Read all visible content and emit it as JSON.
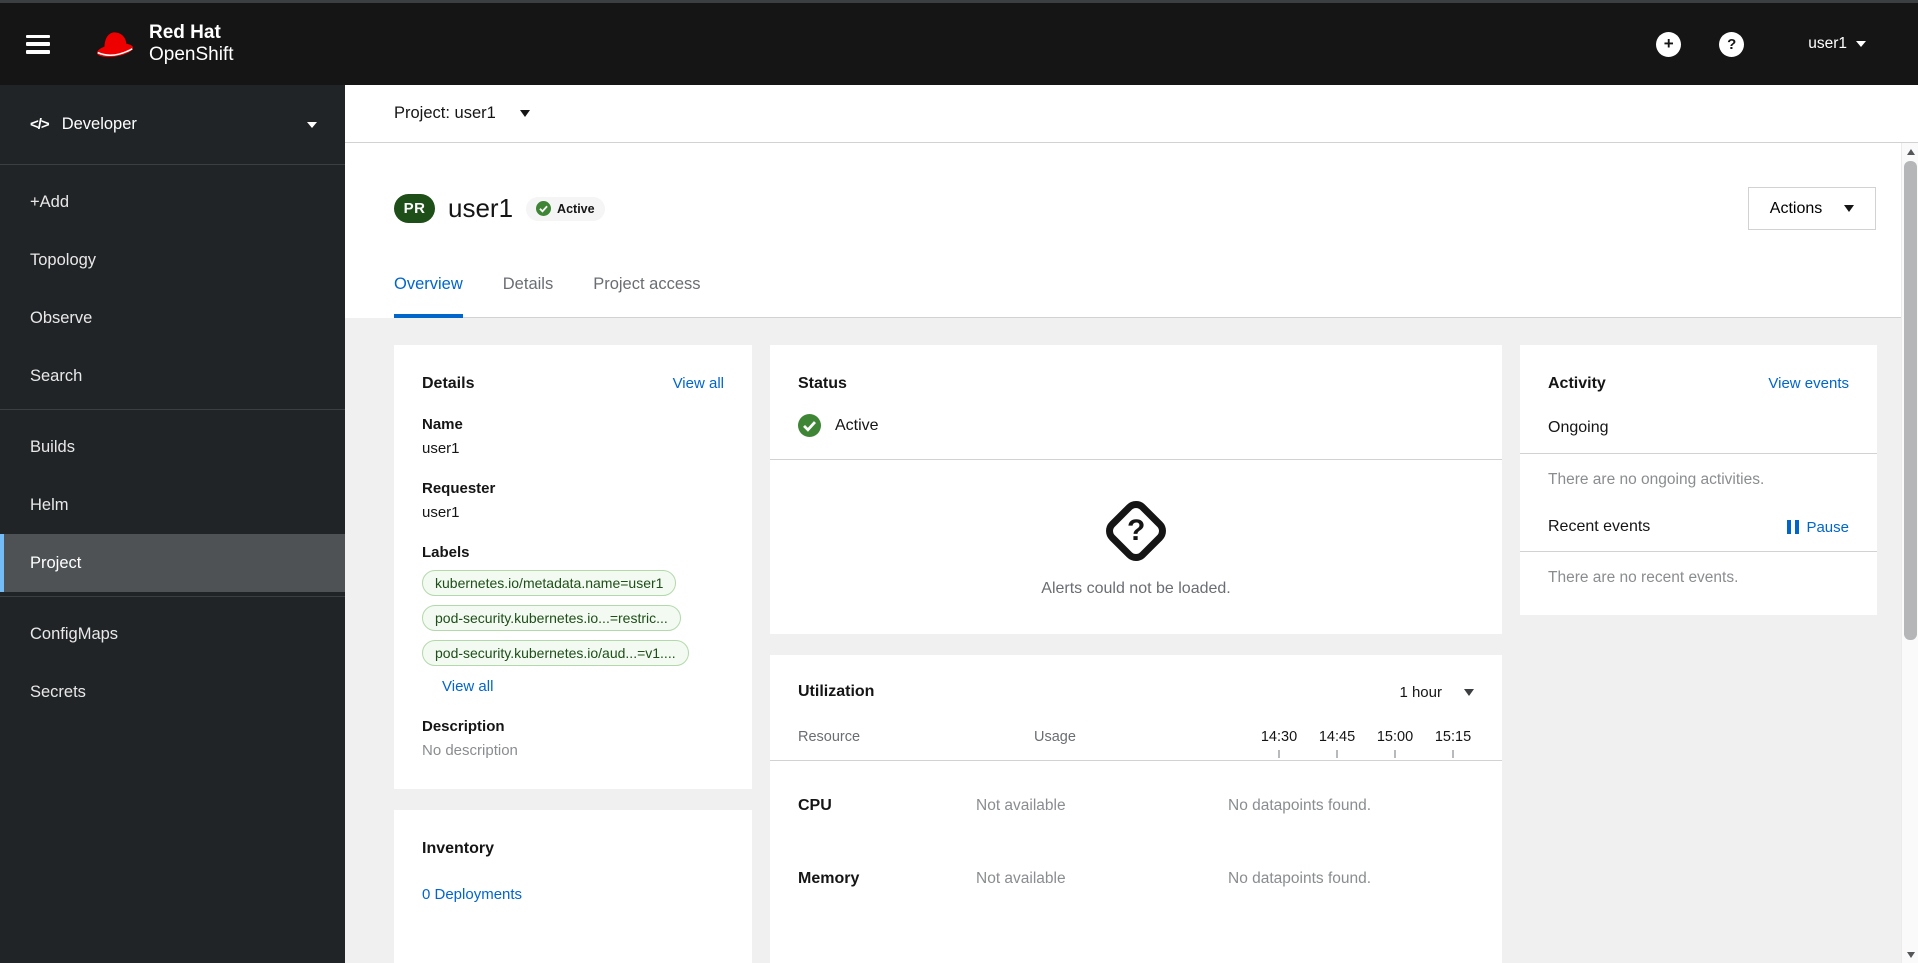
{
  "masthead": {
    "brand": {
      "line1": "Red Hat",
      "line2": "OpenShift"
    },
    "icons": {
      "plus": "+",
      "help": "?"
    },
    "user_menu": {
      "username": "user1"
    }
  },
  "sidebar": {
    "perspective": {
      "label": "Developer"
    },
    "groups": [
      {
        "items": [
          {
            "label": "+Add"
          },
          {
            "label": "Topology"
          },
          {
            "label": "Observe"
          },
          {
            "label": "Search"
          }
        ]
      },
      {
        "items": [
          {
            "label": "Builds"
          },
          {
            "label": "Helm"
          },
          {
            "label": "Project",
            "selected": true
          }
        ]
      },
      {
        "items": [
          {
            "label": "ConfigMaps"
          },
          {
            "label": "Secrets"
          }
        ]
      }
    ]
  },
  "project_bar": {
    "label": "Project: user1"
  },
  "page_header": {
    "resource_badge": "PR",
    "title": "user1",
    "status_badge": "Active",
    "actions_label": "Actions"
  },
  "tabs": [
    {
      "label": "Overview",
      "active": true
    },
    {
      "label": "Details",
      "active": false
    },
    {
      "label": "Project access",
      "active": false
    }
  ],
  "details_card": {
    "heading": "Details",
    "view_all_link": "View all",
    "name_label": "Name",
    "name_value": "user1",
    "requester_label": "Requester",
    "requester_value": "user1",
    "labels_label": "Labels",
    "labels": [
      "kubernetes.io/metadata.name=user1",
      "pod-security.kubernetes.io...=restric...",
      "pod-security.kubernetes.io/aud...=v1...."
    ],
    "labels_view_all_link": "View all",
    "description_label": "Description",
    "description_value": "No description"
  },
  "status_card": {
    "heading": "Status",
    "state": "Active",
    "alerts_message": "Alerts could not be loaded."
  },
  "activity_card": {
    "heading": "Activity",
    "view_events_link": "View events",
    "ongoing_heading": "Ongoing",
    "ongoing_empty": "There are no ongoing activities.",
    "recent_heading": "Recent events",
    "pause_label": "Pause",
    "recent_empty": "There are no recent events."
  },
  "utilization_card": {
    "heading": "Utilization",
    "duration": "1 hour",
    "columns": {
      "resource": "Resource",
      "usage": "Usage"
    },
    "times": [
      "14:30",
      "14:45",
      "15:00",
      "15:15"
    ],
    "rows": [
      {
        "resource": "CPU",
        "usage": "Not available",
        "chart": "No datapoints found."
      },
      {
        "resource": "Memory",
        "usage": "Not available",
        "chart": "No datapoints found."
      }
    ]
  },
  "inventory_card": {
    "heading": "Inventory",
    "items": [
      {
        "label": "0 Deployments"
      }
    ]
  },
  "colors": {
    "masthead_bg": "#151515",
    "sidebar_bg": "#212427",
    "selected_nav_bg": "#4f5255",
    "selected_nav_border": "#73bcf7",
    "link_blue": "#0066cc",
    "success_green": "#3e8635",
    "resource_badge_green": "#1e4f18",
    "label_pill_bg": "#f3faf2",
    "label_pill_border": "#b3d9ab",
    "content_bg": "#f0f0f0"
  }
}
